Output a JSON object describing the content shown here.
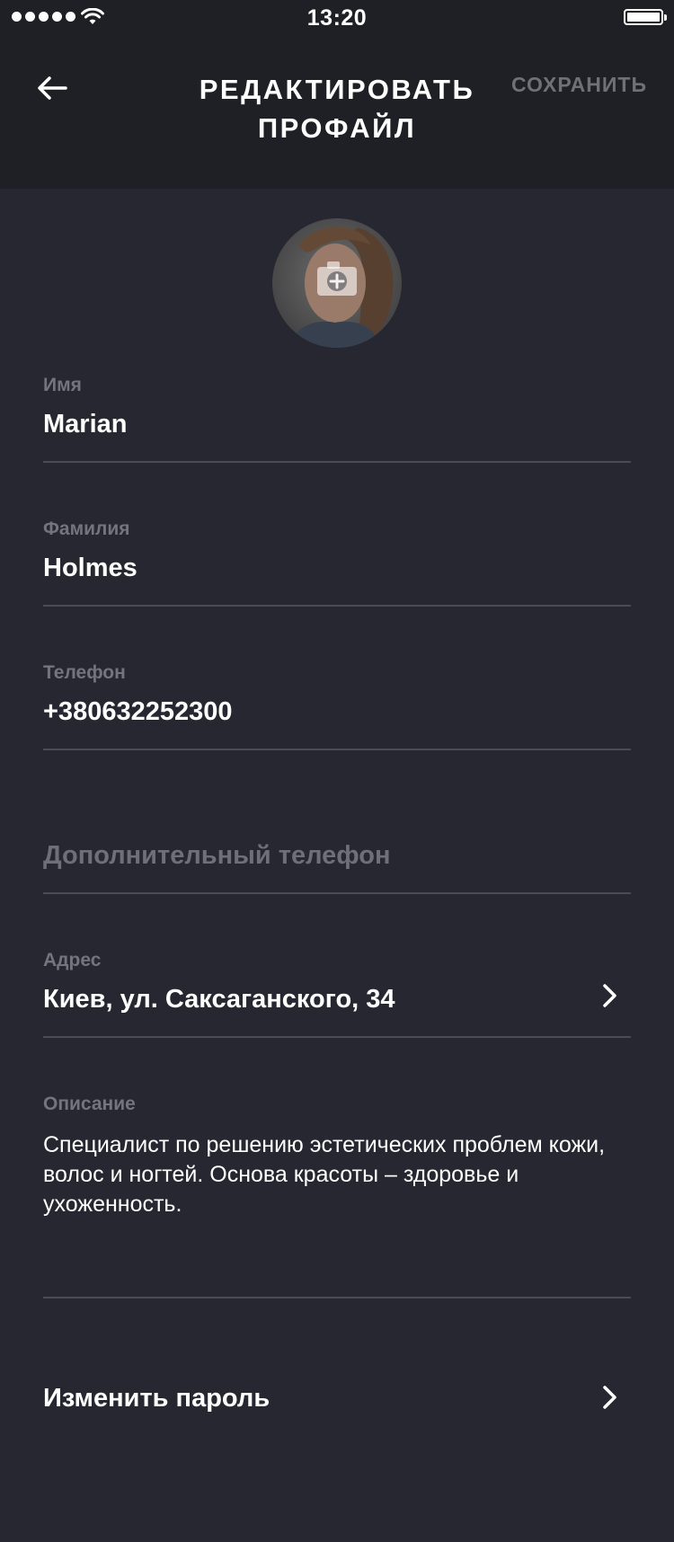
{
  "status_bar": {
    "time": "13:20"
  },
  "nav": {
    "title": "РЕДАКТИРОВАТЬ ПРОФАЙЛ",
    "save_label": "СОХРАНИТЬ"
  },
  "profile": {
    "first_name_label": "Имя",
    "first_name": "Marian",
    "last_name_label": "Фамилия",
    "last_name": "Holmes",
    "phone_label": "Телефон",
    "phone": "+380632252300",
    "extra_phone_placeholder": "Дополнительный телефон",
    "address_label": "Адрес",
    "address": "Киев, ул. Саксаганского, 34",
    "description_label": "Описание",
    "description": "Специалист по решению эстетических проблем кожи, волос и ногтей. Основа красоты – здоровье и ухоженность."
  },
  "change_password_label": "Изменить пароль",
  "colors": {
    "background": "#262730",
    "header": "#1f2025",
    "divider": "#4a4b53",
    "muted_text": "#73747c"
  },
  "icons": [
    "back-arrow-icon",
    "camera-plus-icon",
    "chevron-right-icon",
    "wifi-icon",
    "battery-icon"
  ]
}
